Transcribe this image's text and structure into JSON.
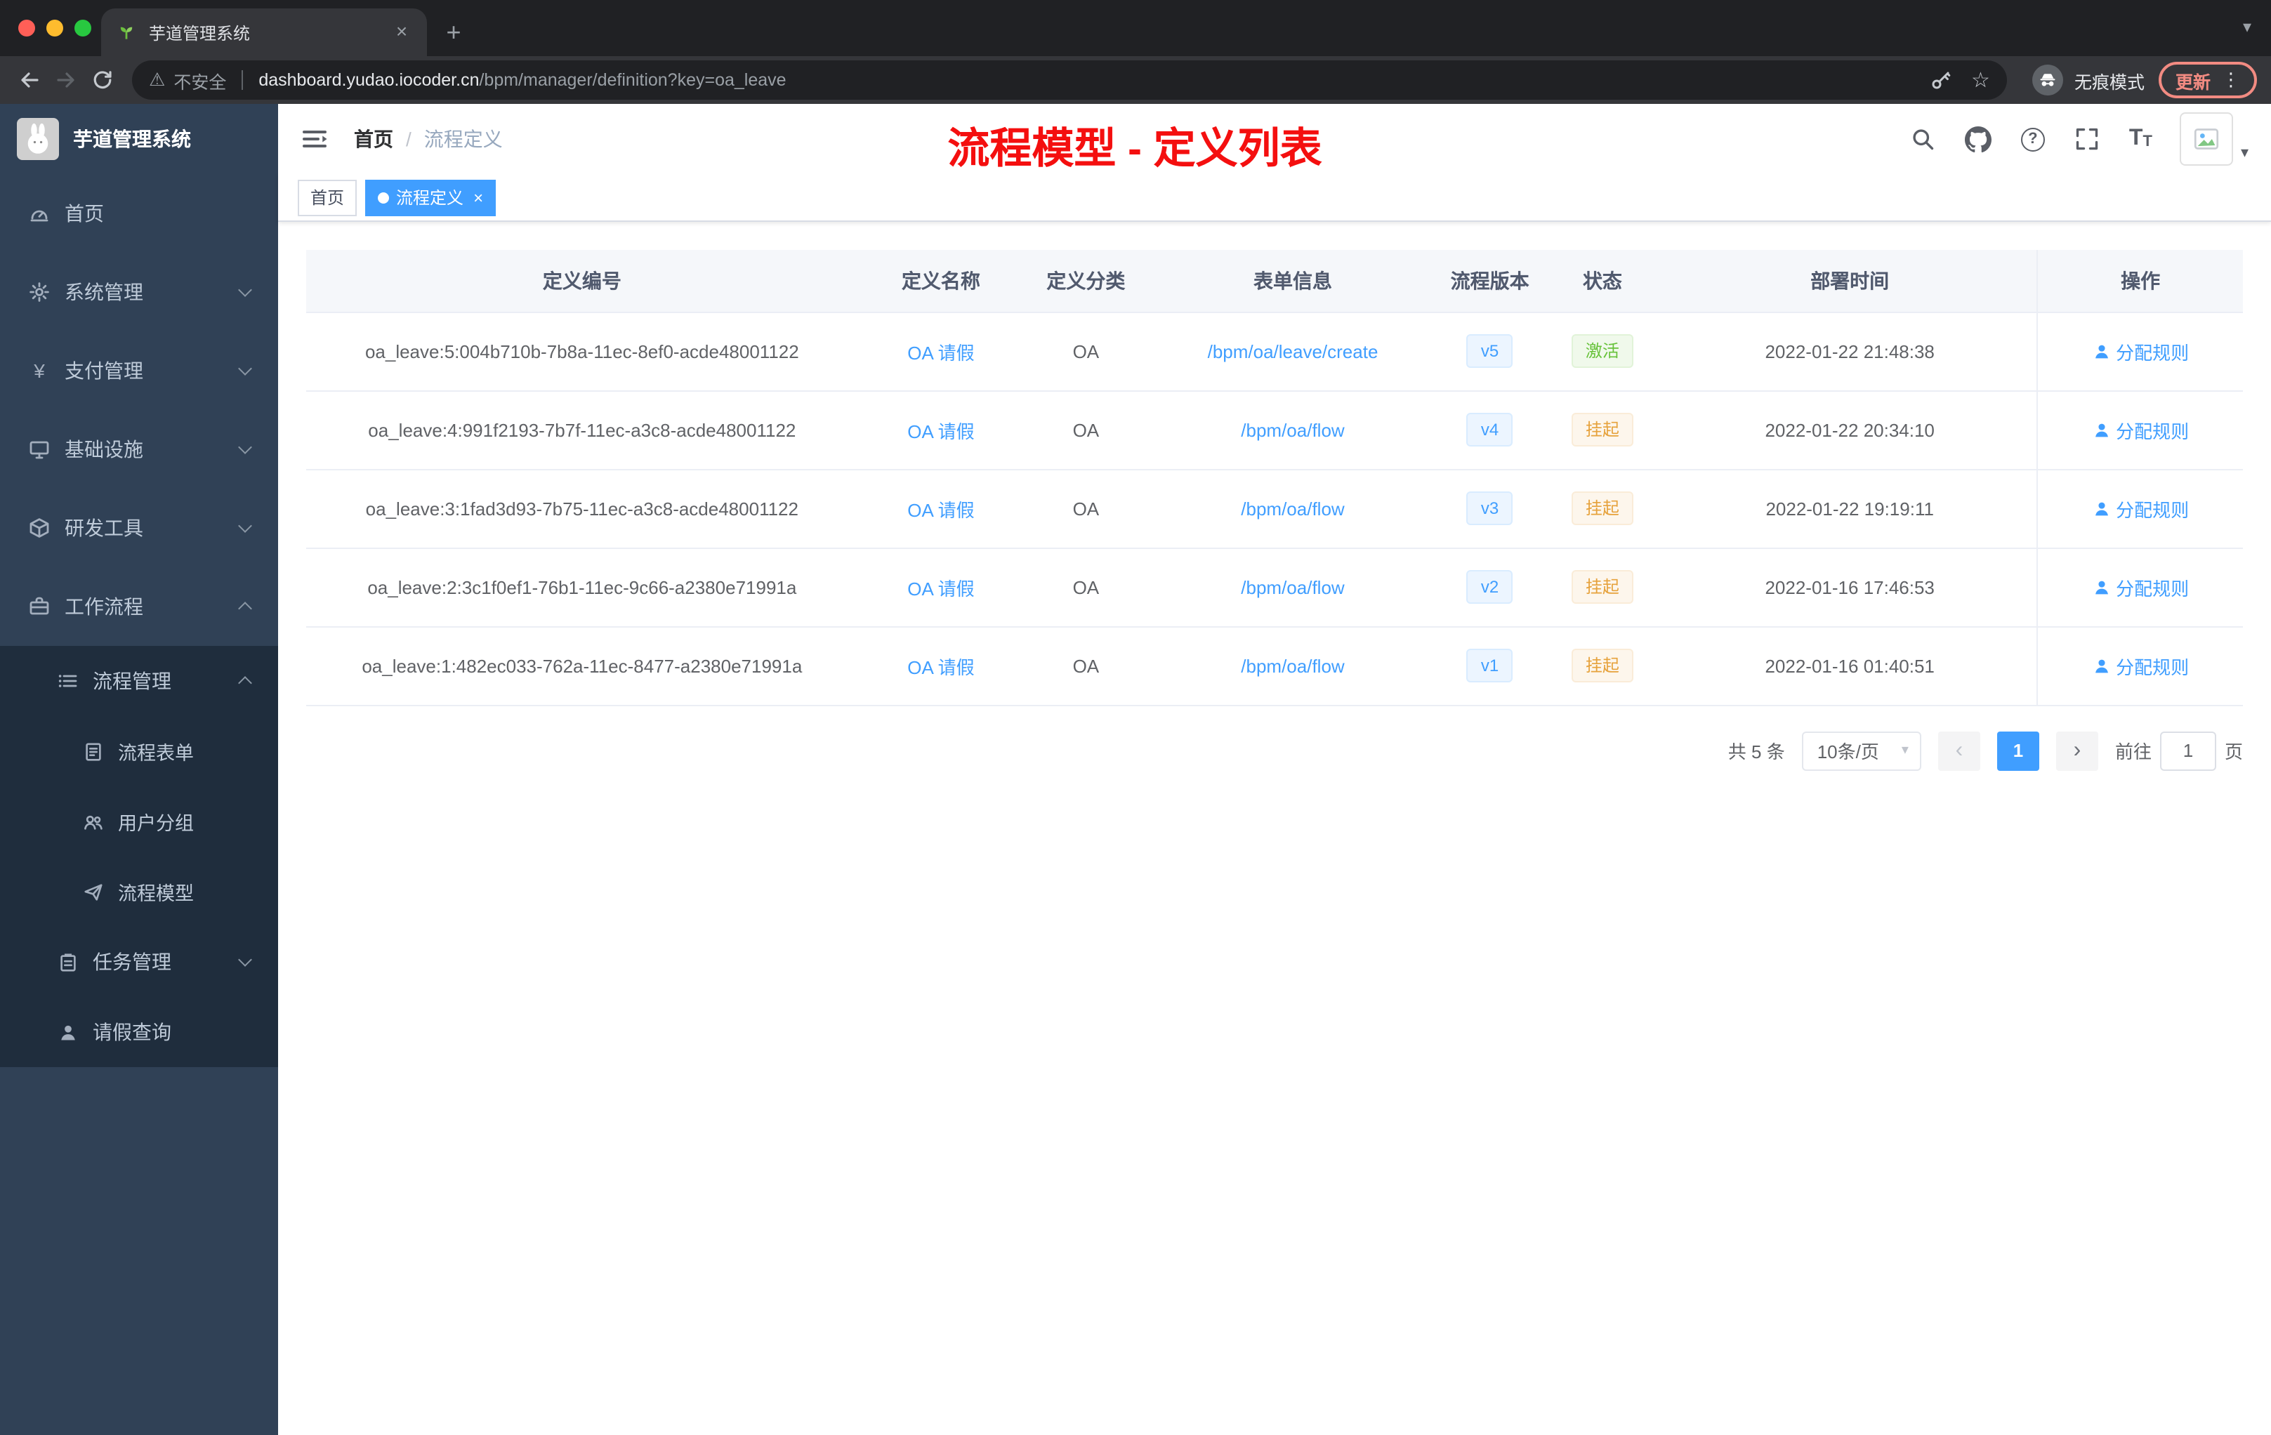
{
  "colors": {
    "accent": "#409eff",
    "success": "#67c23a",
    "warning": "#e6a23c",
    "annotation_red": "#f40f0f",
    "sidebar_bg": "#304156",
    "submenu_bg": "#1f2d3d",
    "update_chip": "#f28b82"
  },
  "icons": {
    "close": "×",
    "plus": "+",
    "kebab": "⋮",
    "caret_down": "▾",
    "chevron_left": "‹",
    "chevron_right": "›",
    "question": "?",
    "warning": "⚠",
    "star": "☆",
    "yuan": "¥",
    "slash": "/",
    "big_t": "T",
    "small_t": "T"
  },
  "browser": {
    "tab_title": "芋道管理系统",
    "security_label": "不安全",
    "url_host": "dashboard.yudao.iocoder.cn",
    "url_path": "/bpm/manager/definition?key=oa_leave",
    "incognito_label": "无痕模式",
    "update_label": "更新"
  },
  "sidebar": {
    "app_title": "芋道管理系统",
    "items": [
      {
        "label": "首页"
      },
      {
        "label": "系统管理"
      },
      {
        "label": "支付管理"
      },
      {
        "label": "基础设施"
      },
      {
        "label": "研发工具"
      },
      {
        "label": "工作流程"
      },
      {
        "label": "流程管理"
      },
      {
        "label": "流程表单"
      },
      {
        "label": "用户分组"
      },
      {
        "label": "流程模型"
      },
      {
        "label": "任务管理"
      },
      {
        "label": "请假查询"
      }
    ]
  },
  "header": {
    "breadcrumb": [
      "首页",
      "流程定义"
    ],
    "annotation": "流程模型 - 定义列表"
  },
  "tags": [
    {
      "label": "首页"
    },
    {
      "label": "流程定义"
    }
  ],
  "table": {
    "columns": [
      "定义编号",
      "定义名称",
      "定义分类",
      "表单信息",
      "流程版本",
      "状态",
      "部署时间",
      "操作"
    ],
    "rows": [
      {
        "id": "oa_leave:5:004b710b-7b8a-11ec-8ef0-acde48001122",
        "name": "OA 请假",
        "category": "OA",
        "form": "/bpm/oa/leave/create",
        "version": "v5",
        "status": "激活",
        "time": "2022-01-22 21:48:38",
        "action": "分配规则"
      },
      {
        "id": "oa_leave:4:991f2193-7b7f-11ec-a3c8-acde48001122",
        "name": "OA 请假",
        "category": "OA",
        "form": "/bpm/oa/flow",
        "version": "v4",
        "status": "挂起",
        "time": "2022-01-22 20:34:10",
        "action": "分配规则"
      },
      {
        "id": "oa_leave:3:1fad3d93-7b75-11ec-a3c8-acde48001122",
        "name": "OA 请假",
        "category": "OA",
        "form": "/bpm/oa/flow",
        "version": "v3",
        "status": "挂起",
        "time": "2022-01-22 19:19:11",
        "action": "分配规则"
      },
      {
        "id": "oa_leave:2:3c1f0ef1-76b1-11ec-9c66-a2380e71991a",
        "name": "OA 请假",
        "category": "OA",
        "form": "/bpm/oa/flow",
        "version": "v2",
        "status": "挂起",
        "time": "2022-01-16 17:46:53",
        "action": "分配规则"
      },
      {
        "id": "oa_leave:1:482ec033-762a-11ec-8477-a2380e71991a",
        "name": "OA 请假",
        "category": "OA",
        "form": "/bpm/oa/flow",
        "version": "v1",
        "status": "挂起",
        "time": "2022-01-16 01:40:51",
        "action": "分配规则"
      }
    ]
  },
  "pagination": {
    "total": "共 5 条",
    "page_size": "10条/页",
    "current_page": "1",
    "goto_label": "前往",
    "goto_value": "1",
    "page_unit": "页"
  }
}
